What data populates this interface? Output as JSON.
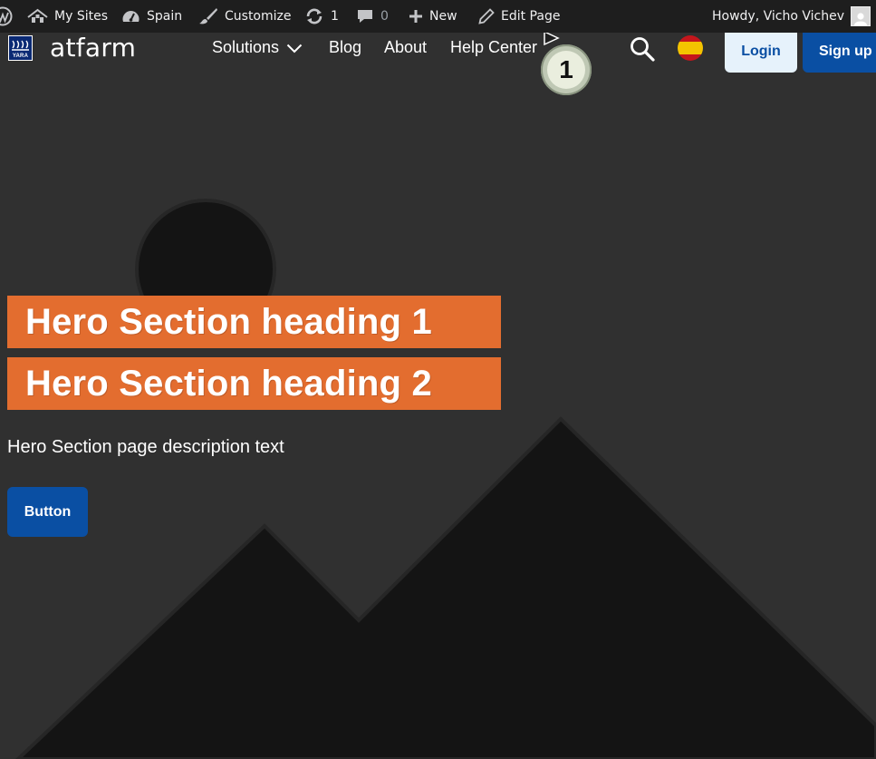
{
  "admin_bar": {
    "my_sites": "My Sites",
    "site_name": "Spain",
    "customize": "Customize",
    "updates_count": "1",
    "comments_count": "0",
    "new": "New",
    "edit_page": "Edit Page",
    "greeting": "Howdy, Vicho Vichev"
  },
  "header": {
    "logo_text": "YARA",
    "brand": "atfarm",
    "nav": {
      "solutions": "Solutions",
      "blog": "Blog",
      "about": "About",
      "help_center": "Help Center"
    },
    "login": "Login",
    "signup": "Sign up",
    "language_flag": "spain-flag"
  },
  "step_marker": "1",
  "hero": {
    "heading_1": "Hero Section heading 1",
    "heading_2": "Hero Section heading 2",
    "description": "Hero Section page description text",
    "button": "Button"
  },
  "colors": {
    "adminbar_bg": "#1e1e1e",
    "page_bg": "#303030",
    "accent_orange": "#e36d2f",
    "primary_blue": "#0a4fa3",
    "login_bg": "#e6f2fb"
  }
}
